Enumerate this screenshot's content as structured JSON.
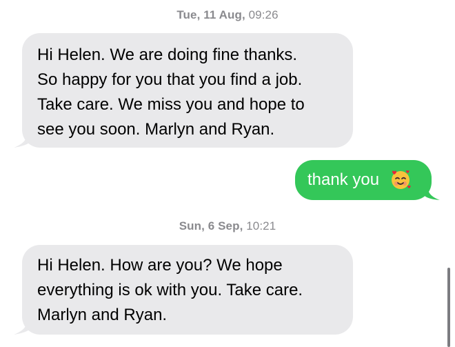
{
  "thread": {
    "timestamp1": {
      "day": "Tue, 11 Aug,",
      "time": " 09:26"
    },
    "message1_lines": [
      "Hi Helen. We are doing fine thanks.",
      "So happy for you that you find a job.",
      "Take care. We miss you and hope to",
      "see you soon. Marlyn and Ryan."
    ],
    "reply": {
      "text": "thank you",
      "emoji_icon": "smiling-face-with-hearts-icon"
    },
    "timestamp2": {
      "day": "Sun, 6 Sep,",
      "time": " 10:21"
    },
    "message2_lines": [
      "Hi Helen. How are you? We hope",
      "everything is ok with you. Take care.",
      "Marlyn and Ryan."
    ]
  },
  "colors": {
    "incoming_bubble": "#e9e9eb",
    "outgoing_bubble": "#34c759",
    "timestamp_text": "#8a8a8e"
  }
}
